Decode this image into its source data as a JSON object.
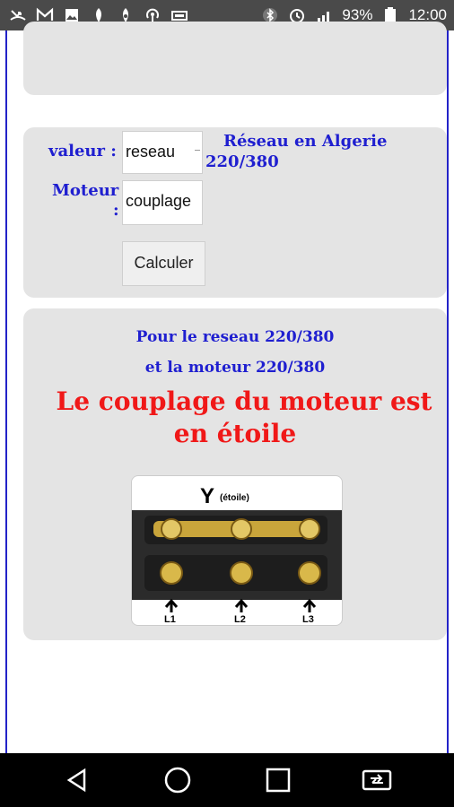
{
  "status_bar": {
    "battery": "93%",
    "time": "12:00",
    "icons_left": [
      "missed-call-icon",
      "gmail-icon",
      "image-icon",
      "app-icon",
      "app2-icon",
      "hotspot-icon",
      "voicemail-icon"
    ],
    "icons_right": [
      "bluetooth-icon",
      "alarm-icon",
      "signal-icon",
      "battery-icon"
    ]
  },
  "form": {
    "valeur_label": "valeur :",
    "valeur_value": "reseau",
    "moteur_label_1": "Moteur",
    "moteur_label_2": ":",
    "moteur_value": "couplage",
    "info_line1": "Réseau en Algerie",
    "info_line2": "220/380",
    "calculate_button": "Calculer"
  },
  "result": {
    "line1": "Pour le reseau 220/380",
    "line2": "et la moteur 220/380",
    "conclusion_line1": "Le couplage du moteur est",
    "conclusion_line2": "en étoile",
    "diagram_symbol": "Y",
    "diagram_caption": "(étoile)",
    "terminals": [
      "L1",
      "L2",
      "L3"
    ]
  },
  "colors": {
    "label_blue": "#1f1fd0",
    "result_red": "#f01818",
    "card_bg": "#e4e4e4",
    "border_blue": "#2323c8"
  },
  "nav_bar": {
    "icons": [
      "back-icon",
      "home-icon",
      "recents-icon",
      "switch-icon"
    ]
  }
}
